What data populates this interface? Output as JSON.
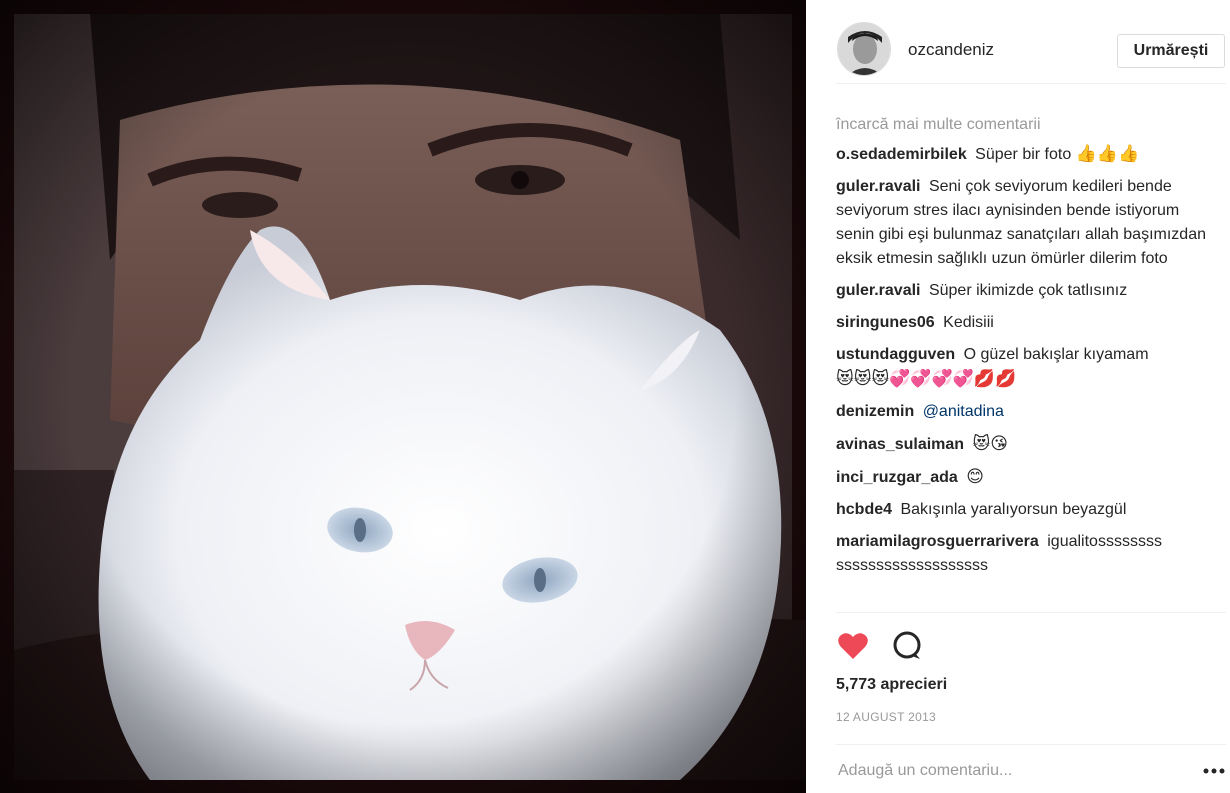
{
  "post": {
    "image_alt": "",
    "author": "ozcandeniz",
    "follow_label": "Urmărești"
  },
  "comments_section": {
    "load_more": "încarcă mai multe comentarii",
    "items": [
      {
        "user": "o.sedademirbilek",
        "text": "Süper bir foto",
        "emoji": "👍👍👍"
      },
      {
        "user": "guler.ravali",
        "text": "Seni çok seviyorum kedileri bende seviyorum stres ilacı aynisinden bende istiyorum senin gibi eşi bulunmaz sanatçıları allah başımızdan eksik etmesin sağlıklı uzun ömürler dilerim foto",
        "emoji": ""
      },
      {
        "user": "guler.ravali",
        "text": "Süper ikimizde çok tatlısınız",
        "emoji": ""
      },
      {
        "user": "siringunes06",
        "text": "Kedisiii",
        "emoji": ""
      },
      {
        "user": "ustundagguven",
        "text": "O güzel bakışlar kıyamam",
        "emoji": "😻😻😻💞💞💞💞💋💋"
      },
      {
        "user": "denizemin",
        "text": "",
        "mention": "@anitadina",
        "emoji": ""
      },
      {
        "user": "avinas_sulaiman",
        "text": "",
        "emoji": "😻😘"
      },
      {
        "user": "inci_ruzgar_ada",
        "text": "",
        "emoji": "😊"
      },
      {
        "user": "hcbde4",
        "text": "Bakışınla yaralıyorsun beyazgül",
        "emoji": ""
      },
      {
        "user": "mariamilagrosguerrarivera",
        "text": "igualitossssssss sssssssssssssssssss",
        "emoji": ""
      }
    ]
  },
  "actions": {
    "like_icon": "heart-icon",
    "comment_icon": "speech-bubble-icon",
    "liked": true,
    "like_color": "#ed4956",
    "likes_text": "5,773 aprecieri",
    "date": "12 AUGUST 2013"
  },
  "add_comment": {
    "placeholder": "Adaugă un comentariu...",
    "more_icon": "ellipsis-icon"
  }
}
